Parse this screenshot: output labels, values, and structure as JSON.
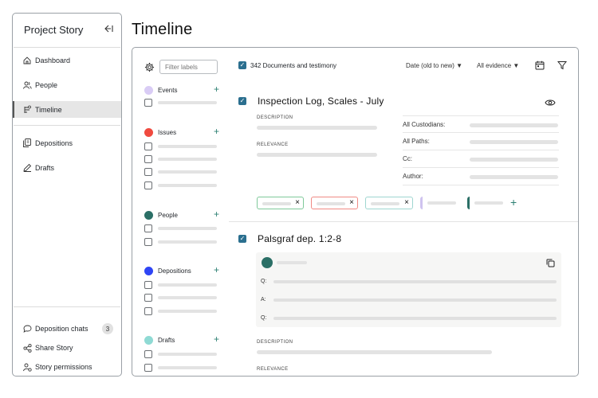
{
  "sidebar": {
    "title": "Project Story",
    "collapse_icon": "collapse-left-icon",
    "nav": [
      {
        "label": "Dashboard",
        "icon": "home-icon"
      },
      {
        "label": "People",
        "icon": "people-icon"
      },
      {
        "label": "Timeline",
        "icon": "timeline-icon",
        "active": true
      },
      {
        "label": "Depositions",
        "icon": "depositions-icon"
      },
      {
        "label": "Drafts",
        "icon": "drafts-icon"
      }
    ],
    "bottom": [
      {
        "label": "Deposition chats",
        "icon": "chat-icon",
        "badge": "3"
      },
      {
        "label": "Share Story",
        "icon": "share-icon"
      },
      {
        "label": "Story permissions",
        "icon": "permissions-icon"
      }
    ]
  },
  "page": {
    "title": "Timeline"
  },
  "filters": {
    "placeholder": "Filter labels",
    "categories": [
      {
        "label": "Events",
        "color": "#d9ccf5",
        "rows": 1
      },
      {
        "label": "Issues",
        "color": "#f04a3f",
        "rows": 4
      },
      {
        "label": "People",
        "color": "#2b6f66",
        "rows": 2
      },
      {
        "label": "Depositions",
        "color": "#2f45f5",
        "rows": 3
      },
      {
        "label": "Drafts",
        "color": "#8fdad4",
        "rows": 2
      }
    ]
  },
  "toolbar": {
    "count_label": "342 Documents and testimony",
    "sort_label": "Date (old to new)",
    "evidence_label": "All evidence"
  },
  "cards": [
    {
      "title": "Inspection Log, Scales - July",
      "description_label": "DESCRIPTION",
      "relevance_label": "RELEVANCE",
      "meta": [
        "All Custodians:",
        "All Paths:",
        "Cc:",
        "Author:"
      ]
    },
    {
      "title": "Palsgraf dep. 1:2-8",
      "qa": [
        "Q:",
        "A:",
        "Q:"
      ],
      "description_label": "DESCRIPTION",
      "relevance_label": "RELEVANCE"
    }
  ],
  "colors": {
    "accent": "#2b6f8f",
    "teal": "#2b7f72",
    "chip_green": "#7fc99a",
    "chip_red": "#f08a84",
    "chip_teal": "#9fd6d0",
    "chip_lavender": "#cfc3ef",
    "chip_dark": "#2b6f66"
  }
}
